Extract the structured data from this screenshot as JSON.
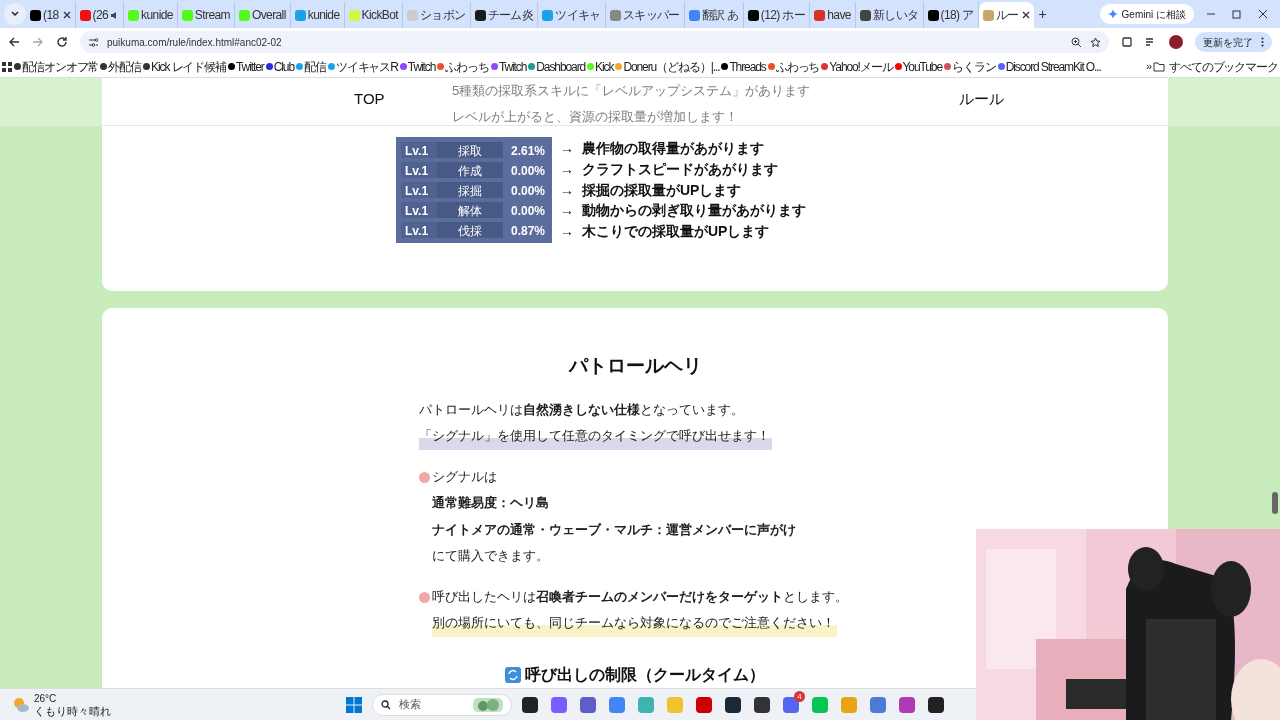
{
  "tabs": [
    {
      "title": "(18",
      "selected": false,
      "audio": false,
      "closable": true
    },
    {
      "title": "(26",
      "selected": false,
      "audio": true,
      "closable": false
    },
    {
      "title": "kunide",
      "selected": false,
      "audio": false,
      "closable": false
    },
    {
      "title": "Stream",
      "selected": false,
      "audio": false,
      "closable": false
    },
    {
      "title": "Overall",
      "selected": false,
      "audio": false,
      "closable": false
    },
    {
      "title": "kunide",
      "selected": false,
      "audio": false,
      "closable": false
    },
    {
      "title": "KickBot",
      "selected": false,
      "audio": false,
      "closable": false
    },
    {
      "title": "ショボン",
      "selected": false,
      "audio": false,
      "closable": false
    },
    {
      "title": "チーム炎",
      "selected": false,
      "audio": false,
      "closable": false
    },
    {
      "title": "ツイキャ",
      "selected": false,
      "audio": false,
      "closable": false
    },
    {
      "title": "スキッパー",
      "selected": false,
      "audio": false,
      "closable": false
    },
    {
      "title": "翻訳 あ",
      "selected": false,
      "audio": false,
      "closable": false
    },
    {
      "title": "(12) ホー",
      "selected": false,
      "audio": false,
      "closable": false
    },
    {
      "title": "have",
      "selected": false,
      "audio": false,
      "closable": false
    },
    {
      "title": "新しいタ",
      "selected": false,
      "audio": false,
      "closable": false
    },
    {
      "title": "(18) ア",
      "selected": false,
      "audio": false,
      "closable": false
    },
    {
      "title": "ルー",
      "selected": true,
      "audio": false,
      "closable": true
    }
  ],
  "new_tab": "+",
  "gemini": "Gemini に相談",
  "address": "puikuma.com/rule/index.html#anc02-02",
  "update_button": "更新を完了",
  "bookmarks": [
    "配信オンオフ常",
    "外配信",
    "Kick レイド候補",
    "Twitter",
    "Club",
    "配信",
    "ツイキャスR",
    "Twitch",
    "ふわっち",
    "Twitch",
    "Dashboard",
    "Kick",
    "Doneru（どねる）|...",
    "Threads",
    "ふわっち",
    "Yahoo!メール",
    "YouTube",
    "らくラン",
    "Discord StreamKit O..."
  ],
  "more_bookmarks": "»",
  "all_bookmarks": "すべてのブックマーク",
  "site_nav": [
    "TOP",
    "ルール"
  ],
  "levels_card": {
    "intro": [
      "5種類の採取系スキルに「レベルアップシステム」があります",
      "レベルが上がると、資源の採取量が増加します！"
    ],
    "rows": [
      {
        "lv": "Lv.1",
        "skill": "採取",
        "rate": "2.61%",
        "effect": "農作物の取得量があがります"
      },
      {
        "lv": "Lv.1",
        "skill": "作成",
        "rate": "0.00%",
        "effect": "クラフトスピードがあがります"
      },
      {
        "lv": "Lv.1",
        "skill": "採掘",
        "rate": "0.00%",
        "effect": "採掘の採取量がUPします"
      },
      {
        "lv": "Lv.1",
        "skill": "解体",
        "rate": "0.00%",
        "effect": "動物からの剥ぎ取り量があがります"
      },
      {
        "lv": "Lv.1",
        "skill": "伐採",
        "rate": "0.87%",
        "effect": "木こりでの採取量がUPします"
      }
    ],
    "arrow": "→"
  },
  "patrol_card": {
    "title": "パトロールヘリ",
    "blocks": [
      {
        "bullet": false,
        "lines": [
          {
            "kind": "text",
            "text": "パトロールヘリは**自然湧きしない仕様**となっています。"
          },
          {
            "kind": "highlight",
            "color": "#dcd8ec",
            "text": "「シグナル」を使用して任意のタイミングで呼び出せます！"
          }
        ]
      },
      {
        "bullet": true,
        "lines": [
          {
            "kind": "text",
            "text": "シグナルは"
          },
          {
            "kind": "bold",
            "text": "通常難易度：ヘリ島"
          },
          {
            "kind": "bold",
            "text": "ナイトメアの通常・ウェーブ・マルチ：運営メンバーに声がけ"
          },
          {
            "kind": "text",
            "text": "にて購入できます。"
          }
        ]
      },
      {
        "bullet": true,
        "lines": [
          {
            "kind": "text",
            "text": "呼び出したヘリは**召喚者チームのメンバーだけをターゲット**とします。"
          },
          {
            "kind": "highlight",
            "color": "#fbf3c8",
            "text": "別の場所にいても、同じチームなら対象になるのでご注意ください！"
          }
        ]
      }
    ],
    "subheading": "呼び出しの制限（クールタイム）"
  },
  "taskbar": {
    "temperature": "26°C",
    "weather": "くもり時々晴れ",
    "search_placeholder": "検索",
    "discord_badge": "4"
  }
}
